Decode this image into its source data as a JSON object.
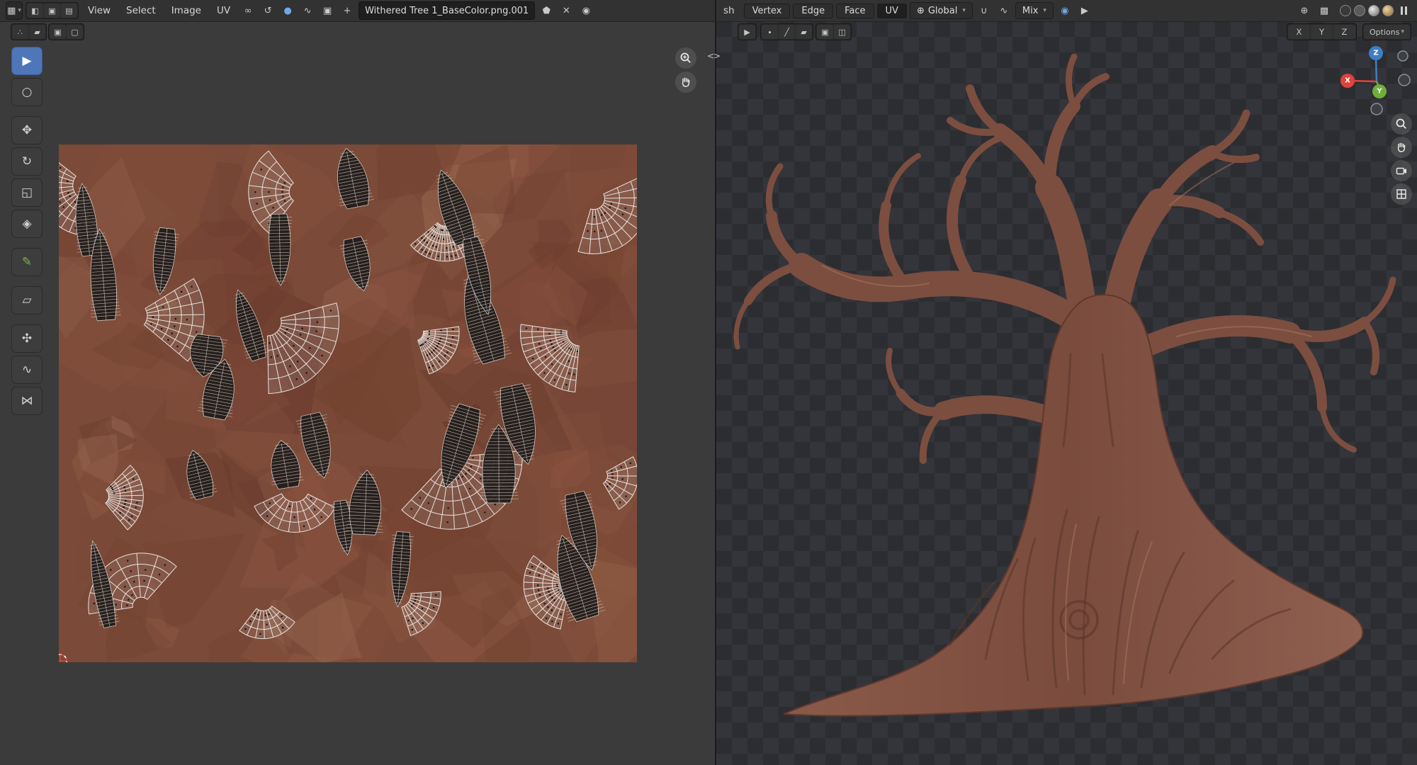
{
  "colors": {
    "accent": "#4f76b8",
    "annotate_green": "#7ab648",
    "axis_x": "#e0433d",
    "axis_y": "#6fae3a",
    "axis_z": "#3d7fc4",
    "bark": "#7c4e40"
  },
  "uv_editor": {
    "header": {
      "editor_glyph": "▦",
      "chevron": "▾",
      "display_toggles": [
        "◧",
        "▣",
        "▤"
      ],
      "menus": [
        "View",
        "Select",
        "Image",
        "UV"
      ],
      "link_glyph": "∞",
      "history_glyph": "↺",
      "snap_glyph": "●",
      "falloff_glyph": "∿",
      "new_image_glyph": "▣",
      "open_image_glyph": "+",
      "image_name": "Withered Tree 1_BaseColor.png.001",
      "shield_glyph": "⬟",
      "close_glyph": "✕",
      "pin_glyph": "◉"
    },
    "select_mode_buttons": [
      "∴",
      "▰",
      "▣",
      "▢"
    ],
    "tools": [
      {
        "name": "tweak",
        "glyph": "▶"
      },
      {
        "name": "select-circle",
        "glyph": "○"
      },
      {
        "name": "move",
        "glyph": "✥"
      },
      {
        "name": "rotate",
        "glyph": "↻"
      },
      {
        "name": "scale",
        "glyph": "◱"
      },
      {
        "name": "transform",
        "glyph": "◈"
      },
      {
        "name": "annotate",
        "glyph": "✎"
      },
      {
        "name": "rip-region",
        "glyph": "▱"
      },
      {
        "name": "grab",
        "glyph": "✣"
      },
      {
        "name": "relax",
        "glyph": "∿"
      },
      {
        "name": "pinch",
        "glyph": "⋈"
      }
    ]
  },
  "viewport": {
    "header": {
      "menu_partial": "sh",
      "menus": [
        "Vertex",
        "Edge",
        "Face",
        "UV"
      ],
      "orientation_glyph": "⊕",
      "orientation": "Global",
      "snap_glyph": "∪",
      "falloff_glyph": "∿",
      "blend": "Mix",
      "mode_icons": [
        "◉",
        "▶",
        "⊕",
        "▩"
      ],
      "options": "Options",
      "chevron": "▾"
    },
    "overlay": {
      "arrow_glyph": "▶",
      "select_modes": [
        "∙",
        "╱",
        "▰"
      ],
      "extra_modes": [
        "▣",
        "◫"
      ],
      "axis_toggles": [
        "X",
        "Y",
        "Z"
      ]
    },
    "gizmo": {
      "x": "X",
      "y": "Y",
      "z": "Z"
    }
  }
}
